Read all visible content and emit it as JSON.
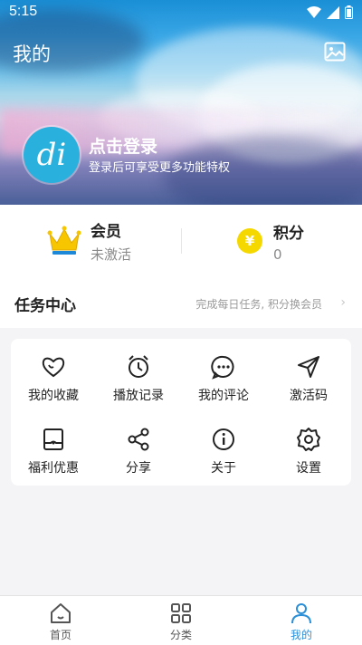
{
  "status_bar": {
    "time": "5:15"
  },
  "header": {
    "title": "我的",
    "login_title": "点击登录",
    "login_subtitle": "登录后可享受更多功能特权",
    "avatar_text": "di"
  },
  "stats": {
    "vip": {
      "label": "会员",
      "value": "未激活"
    },
    "points": {
      "label": "积分",
      "value": "0",
      "icon_text": "¥"
    }
  },
  "task_center": {
    "title": "任务中心",
    "hint": "完成每日任务, 积分换会员"
  },
  "features": [
    {
      "label": "我的收藏",
      "icon": "heart-icon"
    },
    {
      "label": "播放记录",
      "icon": "alarm-clock-icon"
    },
    {
      "label": "我的评论",
      "icon": "comment-icon"
    },
    {
      "label": "激活码",
      "icon": "send-icon"
    },
    {
      "label": "福利优惠",
      "icon": "coupon-icon"
    },
    {
      "label": "分享",
      "icon": "share-icon"
    },
    {
      "label": "关于",
      "icon": "info-icon"
    },
    {
      "label": "设置",
      "icon": "settings-icon"
    }
  ],
  "tabbar": {
    "items": [
      {
        "label": "首页",
        "icon": "home-icon",
        "active": false
      },
      {
        "label": "分类",
        "icon": "grid-icon",
        "active": false
      },
      {
        "label": "我的",
        "icon": "user-icon",
        "active": true
      }
    ]
  },
  "colors": {
    "accent": "#2b8fd8",
    "avatar_bg": "#2ab0dd",
    "crown": "#f7c600",
    "coin": "#f5d800"
  }
}
